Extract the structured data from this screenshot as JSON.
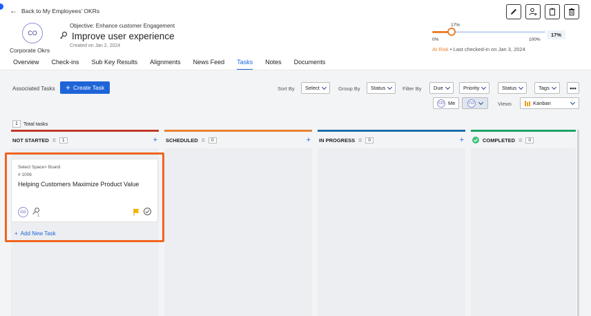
{
  "header": {
    "back_label": "Back to My Employees' OKRs",
    "avatar_initials": "CO",
    "owner": "Corporate Okrs",
    "objective": "Objective: Enhance customer Engagement",
    "title": "Improve user experience",
    "created": "Created on Jan 2, 2024"
  },
  "progress": {
    "value_percent": 17,
    "top_label": "17%",
    "min_label": "0%",
    "max_label": "100%",
    "badge": "17%",
    "status": "At Risk",
    "separator": " • ",
    "last_checkin": "Last checked-in on Jan 3, 2024"
  },
  "tabs": [
    {
      "label": "Overview"
    },
    {
      "label": "Check-ins"
    },
    {
      "label": "Sub Key Results"
    },
    {
      "label": "Alignments"
    },
    {
      "label": "News Feed"
    },
    {
      "label": "Tasks"
    },
    {
      "label": "Notes"
    },
    {
      "label": "Documents"
    }
  ],
  "toolbar": {
    "associated_label": "Associated Tasks",
    "create_label": "Create Task",
    "sort_by_label": "Sort By",
    "sort_value": "Select",
    "group_by_label": "Group By",
    "group_value": "Status",
    "filter_by_label": "Filter By",
    "filter_due": "Due",
    "filter_priority": "Priority",
    "filter_status": "Status",
    "filter_tags": "Tags",
    "more": "•••",
    "me_initials": "CO",
    "me_label": "Me",
    "co_initials": "CO",
    "views_label": "Views",
    "view_value": "Kanban"
  },
  "total": {
    "count": "1",
    "label": "Total tasks"
  },
  "columns": [
    {
      "name": "NOT STARTED",
      "count": "1",
      "color": "#c0392b"
    },
    {
      "name": "SCHEDULED",
      "count": "0",
      "color": "#e8812f"
    },
    {
      "name": "IN PROGRESS",
      "count": "0",
      "color": "#1b6fa8"
    },
    {
      "name": "COMPLETED",
      "count": "0",
      "color": "#1fa26b"
    }
  ],
  "card": {
    "space": "Select Space> Board",
    "id": "# 1006",
    "title": "Helping Customers Maximize Product Value",
    "avatar_initials": "CO",
    "key_count": "1"
  },
  "add_task_label": "Add New Task",
  "colors": {
    "accent": "#1e64d8",
    "highlight": "#f0641d",
    "at_risk": "#e8812f",
    "flag": "#f5b400"
  }
}
